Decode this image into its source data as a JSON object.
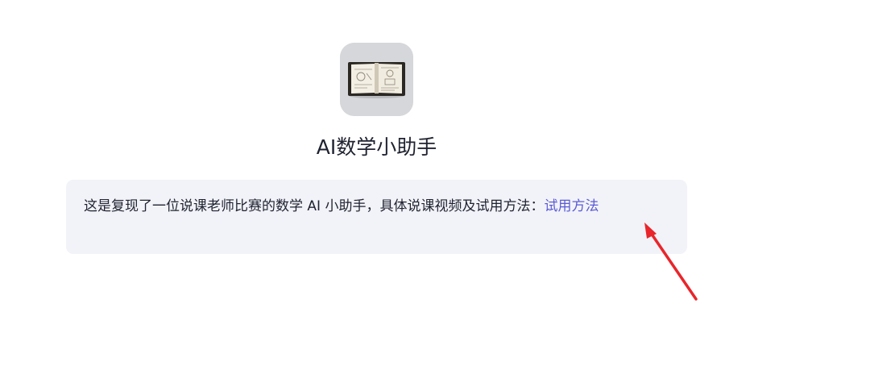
{
  "app": {
    "icon": "open-book-icon",
    "title": "AI数学小助手"
  },
  "description": {
    "text": "这是复现了一位说课老师比赛的数学 AI 小助手，具体说课视频及试用方法：",
    "link_label": "试用方法"
  },
  "colors": {
    "link": "#5b5bd6",
    "card_background": "#f2f3f8",
    "annotation_arrow": "#e8262b"
  }
}
